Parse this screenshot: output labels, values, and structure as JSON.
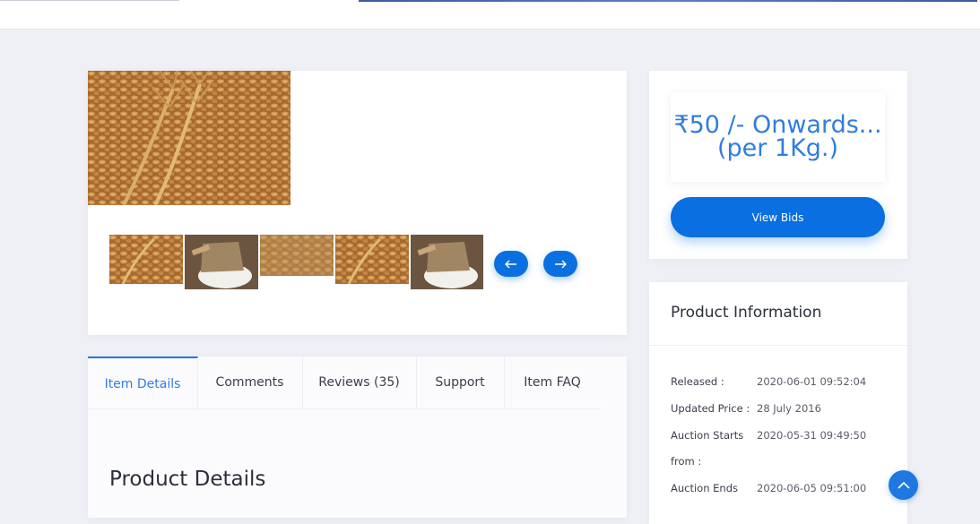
{
  "gallery": {
    "main_image": "wheat grains with ears",
    "thumbnails": [
      "wheat grains",
      "rice sack",
      "oat grains",
      "wheat grains",
      "rice sack"
    ],
    "prev_icon": "arrow-left-icon",
    "next_icon": "arrow-right-icon"
  },
  "tabs": [
    {
      "label": "Item Details",
      "active": true
    },
    {
      "label": "Comments",
      "active": false
    },
    {
      "label": "Reviews (35)",
      "active": false
    },
    {
      "label": "Support",
      "active": false
    },
    {
      "label": "Item FAQ",
      "active": false
    }
  ],
  "details": {
    "title": "Product Details"
  },
  "price": {
    "line1": "₹50 /- Onwards...",
    "line2": "(per 1Kg.)",
    "button_label": "View Bids"
  },
  "product_info": {
    "title": "Product Information",
    "rows": [
      {
        "label": "Released :",
        "value": "2020-06-01 09:52:04"
      },
      {
        "label": "Updated Price :",
        "value": "28 July 2016"
      },
      {
        "label": "Auction Starts",
        "value": "2020-05-31 09:49:50"
      },
      {
        "label": "from :",
        "value": ""
      },
      {
        "label": "Auction Ends",
        "value": "2020-06-05 09:51:00"
      }
    ]
  },
  "colors": {
    "accent": "#0a6fe0",
    "tab_active": "#2f7de1",
    "background": "#eef0f5"
  },
  "scroll_top_icon": "chevron-up-icon"
}
